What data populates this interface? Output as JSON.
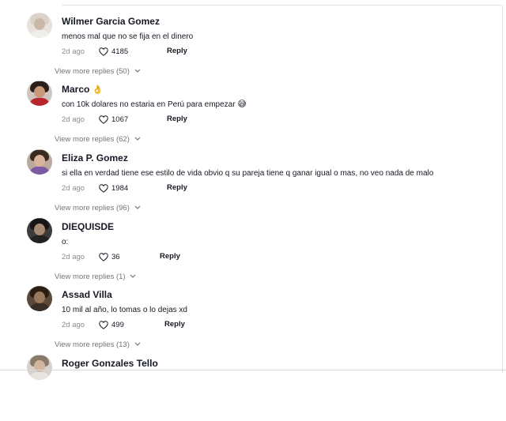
{
  "comments": [
    {
      "username": "Wilmer Garcia Gomez",
      "name_emoji": "",
      "text": "menos mal que no se fija en el dinero",
      "text_emoji": "",
      "date": "2d ago",
      "likes": "4185",
      "reply_label": "Reply",
      "more_replies": "View more replies (50)",
      "avatar": {
        "bg": "#e7e2dc",
        "hair": "#d9d3ca",
        "face": "#c9b8a8",
        "body": "#f0eeea"
      }
    },
    {
      "username": "Marco",
      "name_emoji": "👌",
      "text": "con 10k dolares no estaria en Perú para empezar",
      "text_emoji": "😅",
      "date": "2d ago",
      "likes": "1067",
      "reply_label": "Reply",
      "more_replies": "View more replies (62)",
      "avatar": {
        "bg": "#cfc6c0",
        "hair": "#2a1f1a",
        "face": "#c89878",
        "body": "#b8252d"
      }
    },
    {
      "username": "Eliza P. Gomez",
      "name_emoji": "",
      "text": "si ella en verdad tiene ese estilo de vida obvio q su pareja tiene q ganar igual o mas, no veo nada de malo",
      "text_emoji": "",
      "date": "2d ago",
      "likes": "1984",
      "reply_label": "Reply",
      "more_replies": "View more replies (96)",
      "avatar": {
        "bg": "#b9a99f",
        "hair": "#3b2a22",
        "face": "#d9b39a",
        "body": "#7c5ba6"
      }
    },
    {
      "username": "DIEQUISDE",
      "name_emoji": "",
      "text": "o:",
      "text_emoji": "",
      "date": "2d ago",
      "likes": "36",
      "reply_label": "Reply",
      "more_replies": "View more replies (1)",
      "avatar": {
        "bg": "#3d3b3b",
        "hair": "#171515",
        "face": "#a98a75",
        "body": "#222"
      }
    },
    {
      "username": "Assad Villa",
      "name_emoji": "",
      "text": "10 mil al año, lo tomas o lo dejas xd",
      "text_emoji": "",
      "date": "2d ago",
      "likes": "499",
      "reply_label": "Reply",
      "more_replies": "View more replies (13)",
      "avatar": {
        "bg": "#5b4a3a",
        "hair": "#2a1e14",
        "face": "#9a7a5a",
        "body": "#3a2e24"
      }
    },
    {
      "username": "Roger Gonzales Tello",
      "name_emoji": "",
      "text": "",
      "text_emoji": "",
      "date": "",
      "likes": "",
      "reply_label": "",
      "more_replies": "",
      "avatar": {
        "bg": "#d7d1cb",
        "hair": "#8a7a6a",
        "face": "#d2b7a0",
        "body": "#e8e4e0"
      }
    }
  ],
  "icons": {
    "like": "heart-outline-icon",
    "expand": "chevron-down-icon"
  },
  "colors": {
    "text": "#161823",
    "muted": "#8a8b91",
    "link": "#73747b"
  }
}
